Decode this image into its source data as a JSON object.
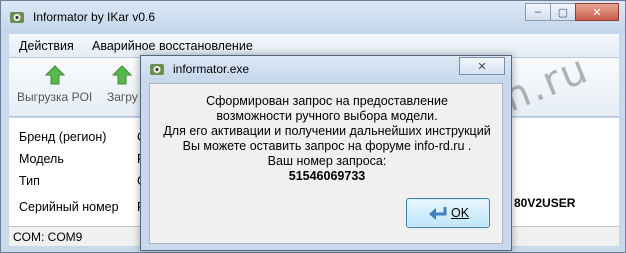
{
  "main_window": {
    "title": "Informator by IKar v0.6",
    "controls": {
      "minimize": "–",
      "maximize": "▢",
      "close": "✕"
    },
    "menu": [
      "Действия",
      "Аварийное восстановление"
    ],
    "toolbar": [
      "Выгрузка POI",
      "Загру"
    ],
    "fields": [
      {
        "label": "Бренд (регион)",
        "value": "C"
      },
      {
        "label": "Модель",
        "value": "R"
      },
      {
        "label": "Тип",
        "value": "G"
      },
      {
        "label": "Серийный номер",
        "value": "R"
      }
    ],
    "serial_right": "80V2USER",
    "status": "COM: COM9"
  },
  "dialog": {
    "title": "informator.exe",
    "close": "✕",
    "message_lines": [
      "Сформирован запрос на предоставление",
      "возможности ручного выбора модели.",
      "Для его активации и получении дальнейших инструкций",
      "Вы можете оставить запрос на форуме info-rd.ru .",
      "Ваш номер запроса:"
    ],
    "request_number": "51546069733",
    "ok_label": "OK"
  },
  "watermark": "rd-forum.ru",
  "colors": {
    "window_frame": "#c9d8ea",
    "arrow_green": "#58b94d",
    "ok_border": "#3c7fb1"
  }
}
